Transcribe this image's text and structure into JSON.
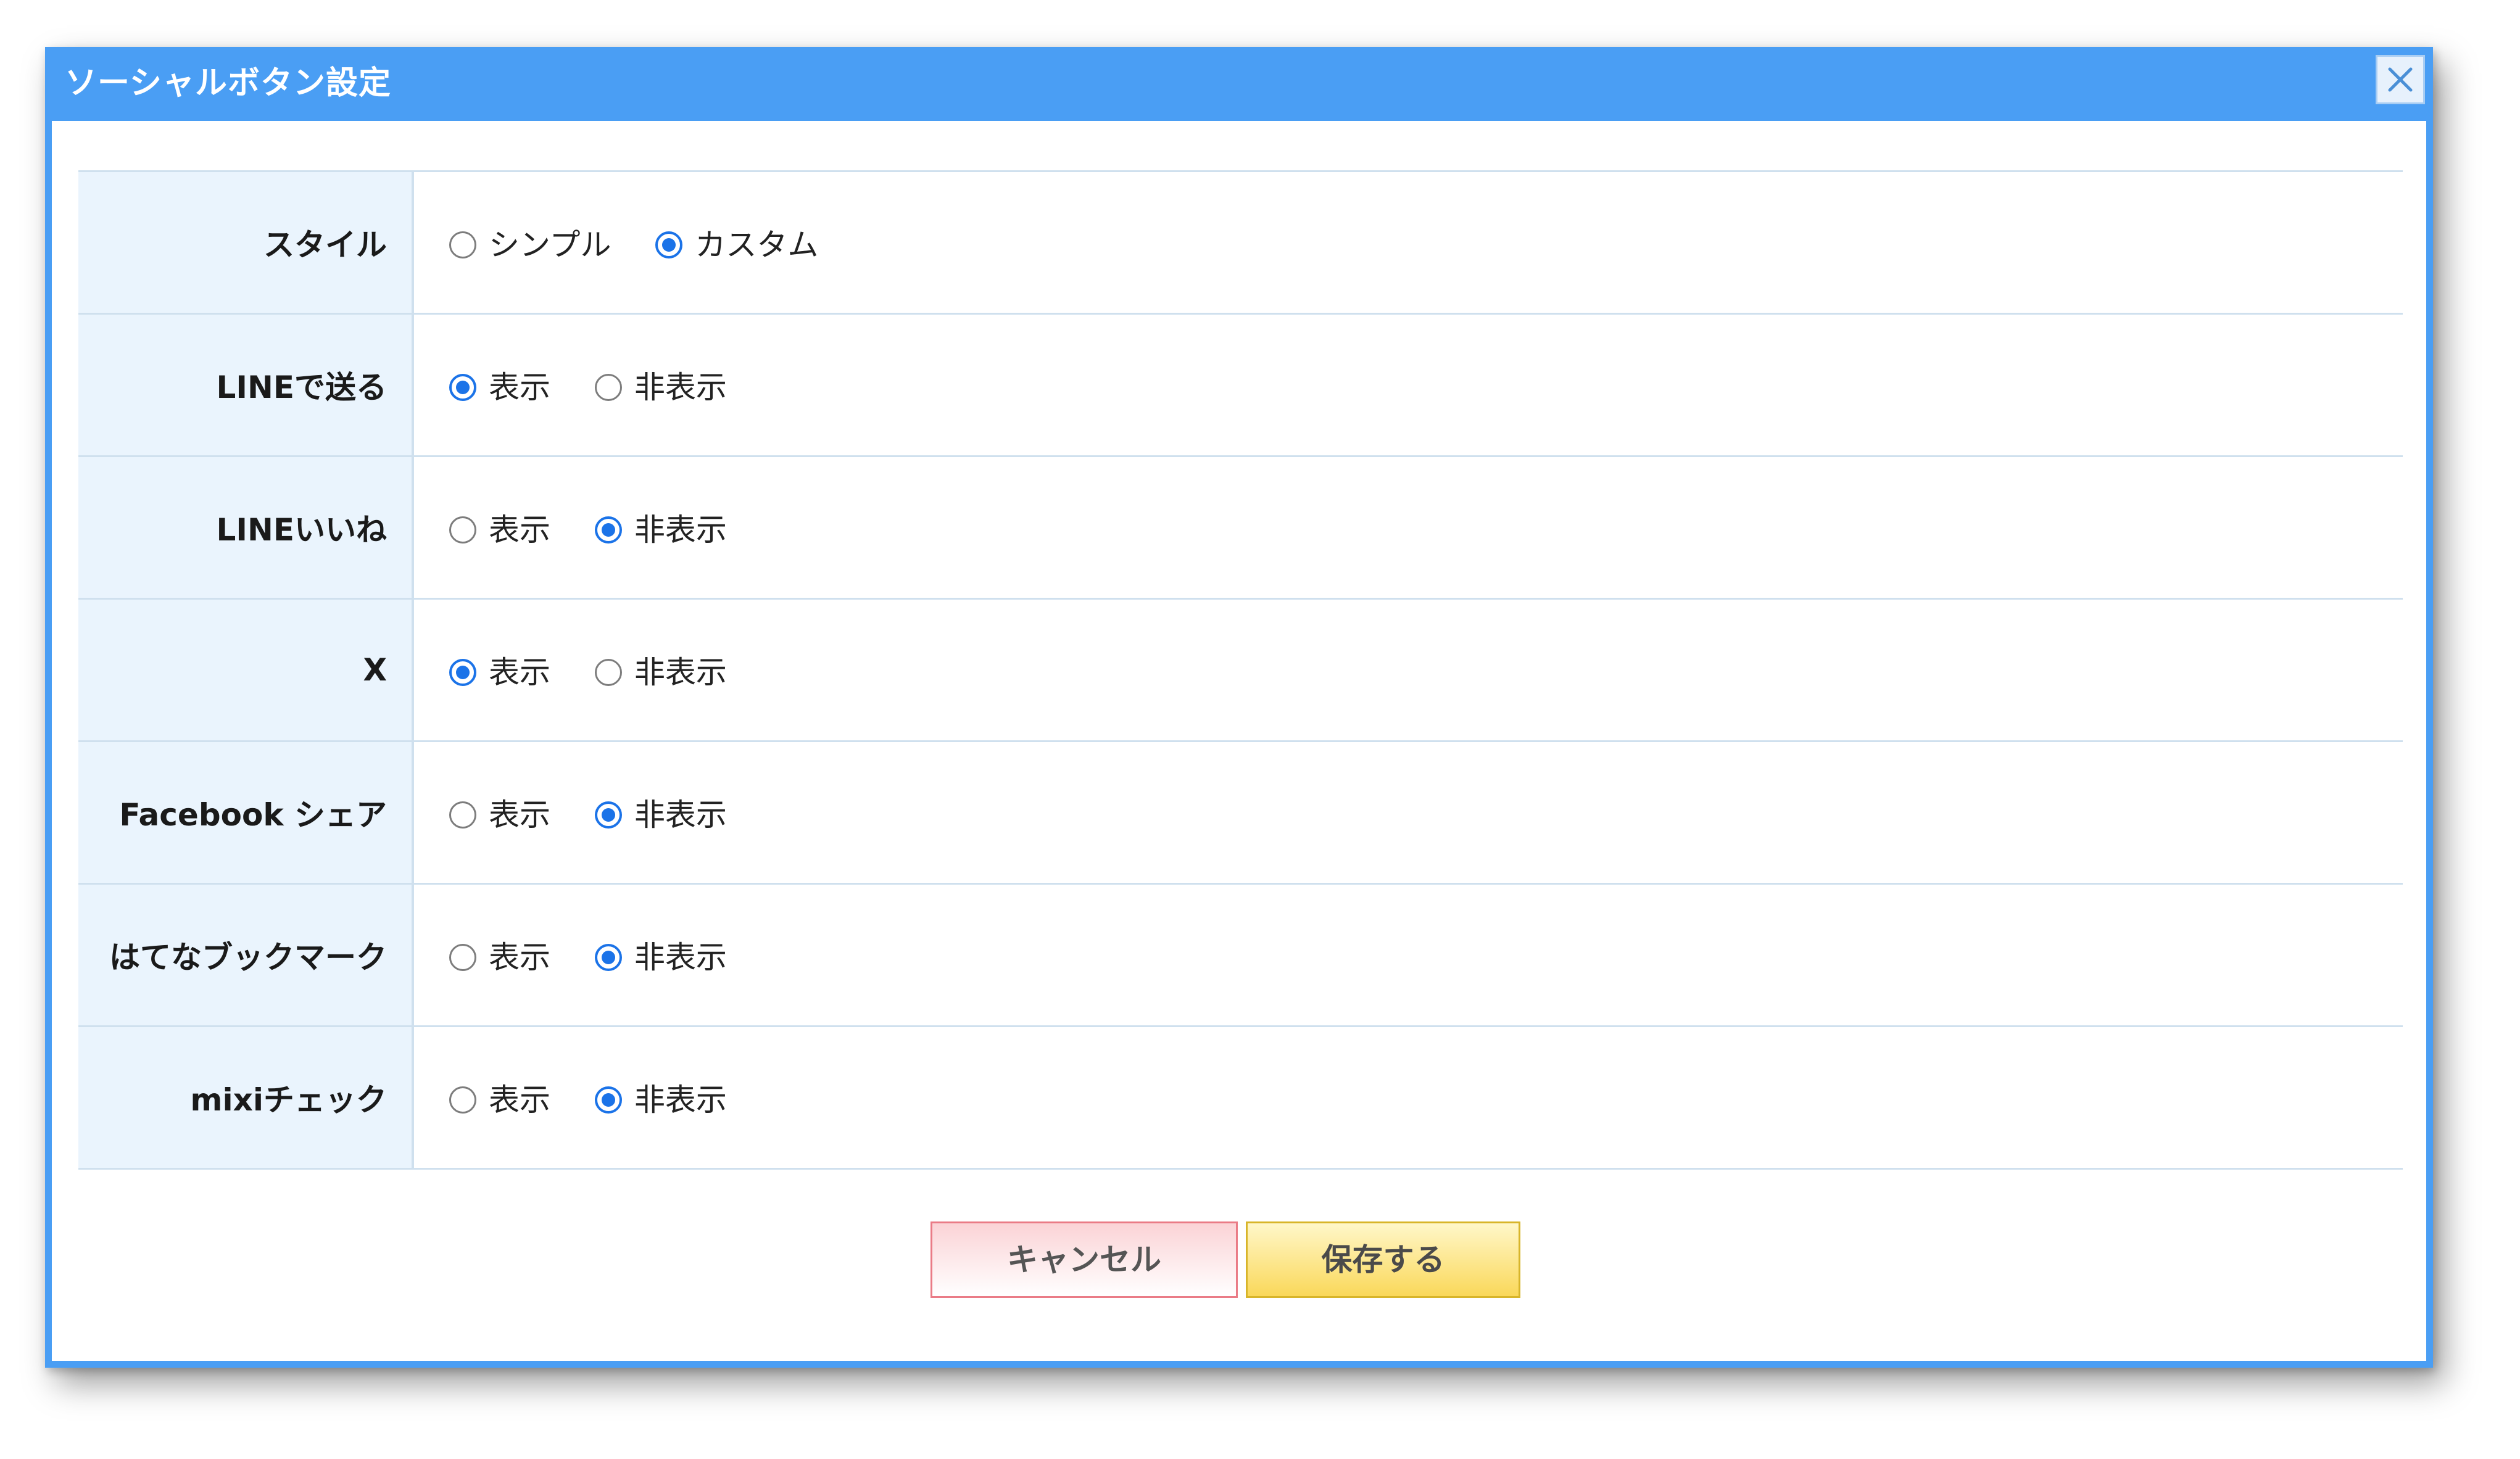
{
  "dialog": {
    "title": "ソーシャルボタン設定",
    "close_icon": "close-icon"
  },
  "rows": [
    {
      "label": "スタイル",
      "options": [
        {
          "label": "シンプル",
          "checked": false
        },
        {
          "label": "カスタム",
          "checked": true
        }
      ]
    },
    {
      "label": "LINEで送る",
      "options": [
        {
          "label": "表示",
          "checked": true
        },
        {
          "label": "非表示",
          "checked": false
        }
      ]
    },
    {
      "label": "LINEいいね",
      "options": [
        {
          "label": "表示",
          "checked": false
        },
        {
          "label": "非表示",
          "checked": true
        }
      ]
    },
    {
      "label": "X",
      "options": [
        {
          "label": "表示",
          "checked": true
        },
        {
          "label": "非表示",
          "checked": false
        }
      ]
    },
    {
      "label": "Facebook シェア",
      "options": [
        {
          "label": "表示",
          "checked": false
        },
        {
          "label": "非表示",
          "checked": true
        }
      ]
    },
    {
      "label": "はてなブックマーク",
      "options": [
        {
          "label": "表示",
          "checked": false
        },
        {
          "label": "非表示",
          "checked": true
        }
      ]
    },
    {
      "label": "mixiチェック",
      "options": [
        {
          "label": "表示",
          "checked": false
        },
        {
          "label": "非表示",
          "checked": true
        }
      ]
    }
  ],
  "buttons": {
    "cancel_label": "キャンセル",
    "save_label": "保存する"
  },
  "colors": {
    "titlebar": "#4a9ef4",
    "radio_checked": "#1b73e8",
    "label_cell_bg": "#eaf4fd",
    "cancel_border": "#ea7b86",
    "save_border": "#d8b52a"
  }
}
